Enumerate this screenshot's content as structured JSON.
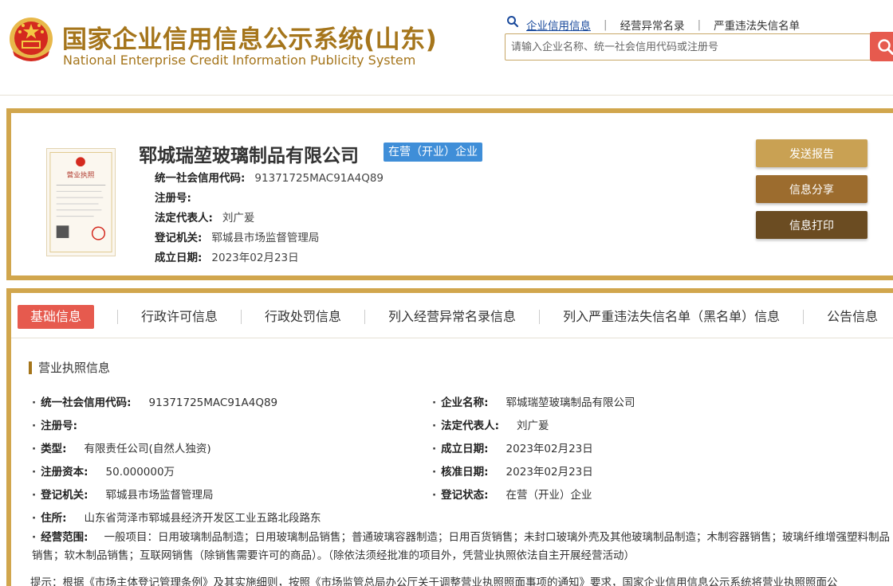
{
  "header": {
    "title_cn": "国家企业信用信息公示系统(山东)",
    "title_en": "National Enterprise Credit Information Publicity System",
    "links": [
      "企业信用信息",
      "经营异常名录",
      "严重违法失信名单"
    ],
    "search_placeholder": "请输入企业名称、统一社会信用代码或注册号"
  },
  "company": {
    "name": "郓城瑞堃玻璃制品有限公司",
    "status": "在营（开业）企业",
    "rows": [
      {
        "label": "统一社会信用代码:",
        "value": "91371725MAC91A4Q89"
      },
      {
        "label": "注册号:",
        "value": ""
      },
      {
        "label": "法定代表人:",
        "value": "刘广爰"
      },
      {
        "label": "登记机关:",
        "value": "郓城县市场监督管理局"
      },
      {
        "label": "成立日期:",
        "value": "2023年02月23日"
      }
    ],
    "buttons": {
      "report": "发送报告",
      "share": "信息分享",
      "print": "信息打印"
    }
  },
  "tabs": [
    "基础信息",
    "行政许可信息",
    "行政处罚信息",
    "列入经营异常名录信息",
    "列入严重违法失信名单（黑名单）信息",
    "公告信息"
  ],
  "section": {
    "title": "营业执照信息",
    "left": [
      {
        "label": "统一社会信用代码:",
        "value": "91371725MAC91A4Q89"
      },
      {
        "label": "注册号:",
        "value": ""
      },
      {
        "label": "类型:",
        "value": "有限责任公司(自然人独资)"
      },
      {
        "label": "注册资本:",
        "value": "50.000000万"
      },
      {
        "label": "登记机关:",
        "value": "郓城县市场监督管理局"
      },
      {
        "label": "住所:",
        "value": "山东省菏泽市郓城县经济开发区工业五路北段路东"
      }
    ],
    "right": [
      {
        "label": "企业名称:",
        "value": "郓城瑞堃玻璃制品有限公司"
      },
      {
        "label": "法定代表人:",
        "value": "刘广爰"
      },
      {
        "label": "成立日期:",
        "value": "2023年02月23日"
      },
      {
        "label": "核准日期:",
        "value": "2023年02月23日"
      },
      {
        "label": "登记状态:",
        "value": "在营（开业）企业"
      }
    ],
    "scope_label": "经营范围:",
    "scope_value": "一般项目：日用玻璃制品制造；日用玻璃制品销售；普通玻璃容器制造；日用百货销售；未封口玻璃外壳及其他玻璃制品制造；木制容器销售；玻璃纤维增强塑料制品销售；软木制品销售；互联网销售（除销售需要许可的商品）。（除依法须经批准的项目外，凭营业执照依法自主开展经营活动）",
    "tip": "提示：根据《市场主体登记管理条例》及其实施细则，按照《市场监管总局办公厅关于调整营业执照照面事项的通知》要求，国家企业信用信息公示系统将营业执照照面公"
  },
  "license_image": {
    "title": "营业执照"
  },
  "colors": {
    "gold": "#a5751b",
    "border": "#d1a64d",
    "red": "#e65a4e",
    "blue_tag": "#3f8ed8"
  }
}
